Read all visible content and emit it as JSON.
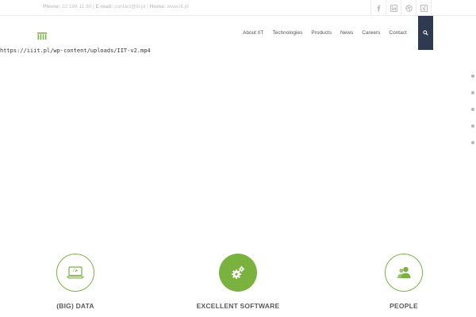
{
  "topbar": {
    "phone_label": "Phone:",
    "phone_value": "22 198 11 80",
    "email_label": "E-mail:",
    "email_value": "contact@iit.pl",
    "home_label": "Home:",
    "home_value": "www.iit.pl",
    "socials": [
      "facebook-icon",
      "linkedin-icon",
      "dribbble-icon",
      "xing-icon"
    ]
  },
  "header": {
    "logo": "iit-logo",
    "nav": [
      "About IIT",
      "Technologies",
      "Products",
      "News",
      "Careers",
      "Contact"
    ],
    "search_icon": "search-icon"
  },
  "hero": {
    "video_url": "https://iiit.pl/wp-content/uploads/IIT-v2.mp4"
  },
  "slider": {
    "dot_count": 5
  },
  "features": [
    {
      "title": "(BIG) DATA",
      "icon": "laptop-icon"
    },
    {
      "title": "EXCELLENT SOFTWARE",
      "icon": "gears-icon"
    },
    {
      "title": "PEOPLE",
      "icon": "users-icon"
    }
  ],
  "colors": {
    "accent": "#7ab23e",
    "search_bg": "#2e3a4f",
    "text": "#5a5a5a"
  }
}
